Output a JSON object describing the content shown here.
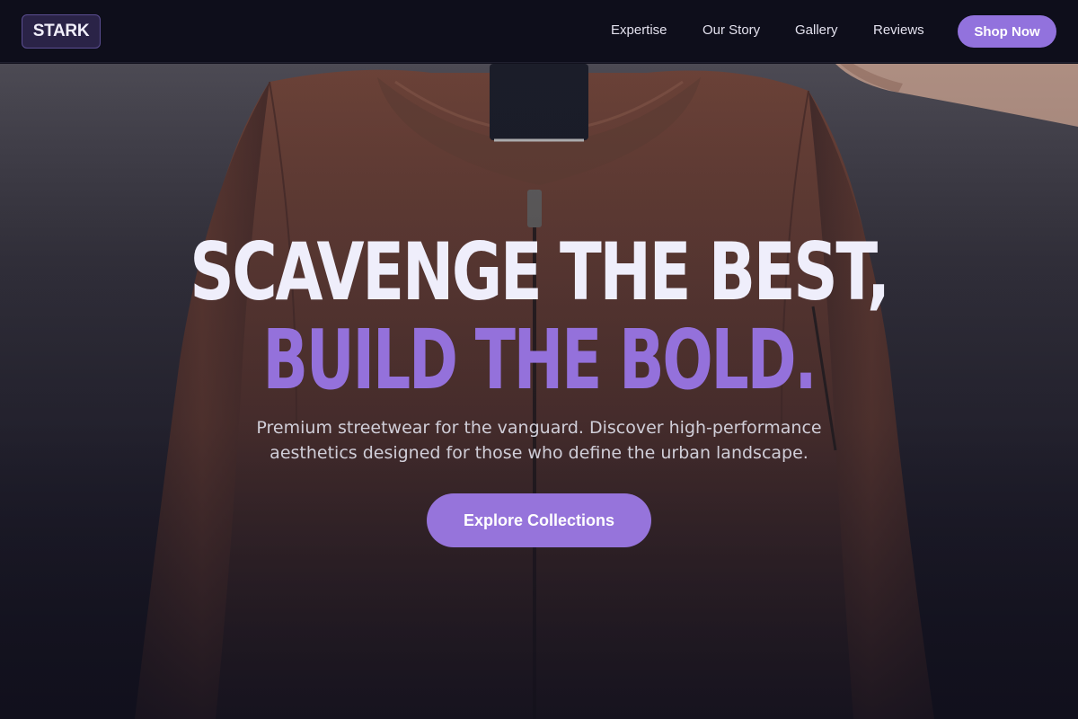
{
  "brand": {
    "logo_text": "STARK"
  },
  "nav": {
    "links": [
      "Expertise",
      "Our Story",
      "Gallery",
      "Reviews"
    ],
    "cta_label": "Shop Now"
  },
  "hero": {
    "headline_line1": "SCAVENGE THE BEST,",
    "headline_line2": "BUILD THE BOLD.",
    "subtitle_line1": "Premium streetwear for the vanguard. Discover high-performance",
    "subtitle_line2": "aesthetics designed for those who define the urban landscape.",
    "cta_label": "Explore Collections",
    "background_image": "rust-bomber-jacket-on-hanger"
  },
  "colors": {
    "accent": "#9272dd",
    "header_bg": "#0e0e1b",
    "headline_light": "#efeefb",
    "headline_accent": "#9471db"
  }
}
